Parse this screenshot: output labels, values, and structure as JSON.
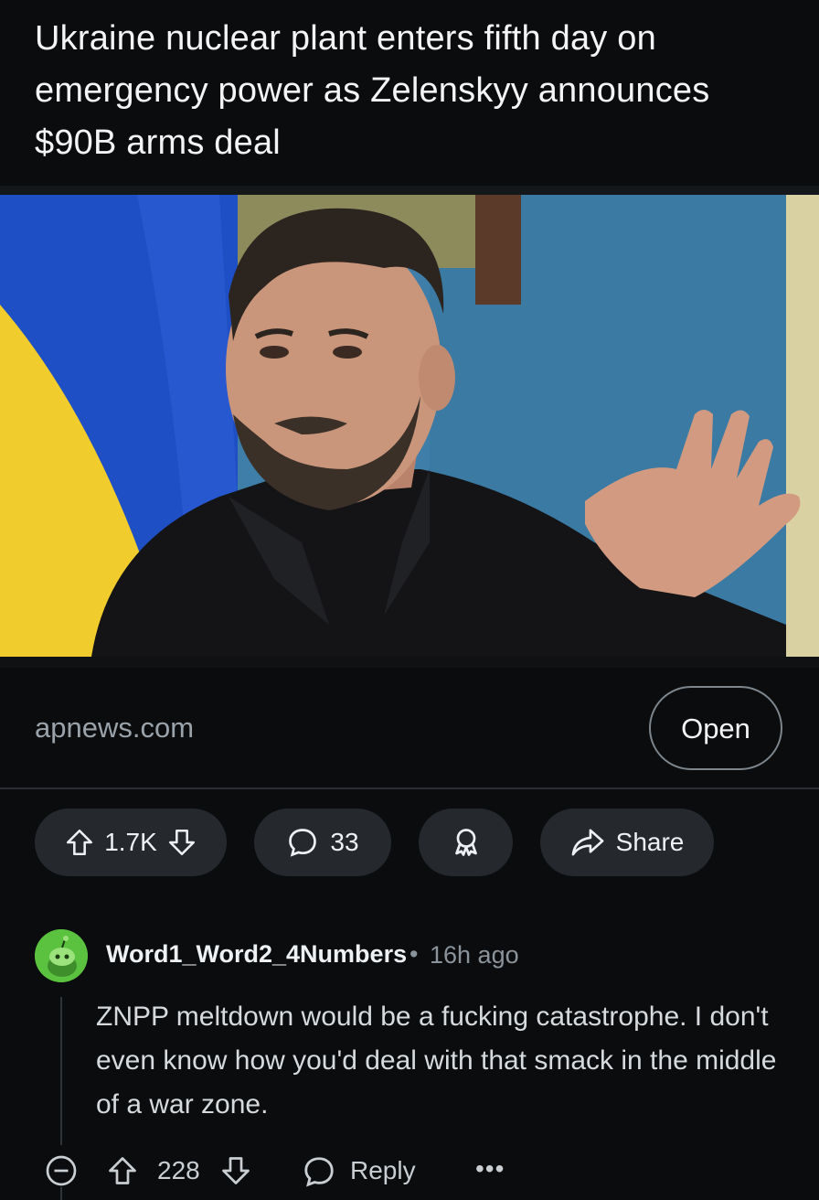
{
  "post": {
    "title": "Ukraine nuclear plant enters fifth day on emergency power as Zelenskyy announces $90B arms deal",
    "link_domain": "apnews.com",
    "open_label": "Open",
    "image_alt": "Zelenskyy speaking in front of a Ukrainian flag"
  },
  "actions": {
    "upvotes": "1.7K",
    "comments": "33",
    "share_label": "Share"
  },
  "comment": {
    "username": "Word1_Word2_4Numbers",
    "separator": "•",
    "age": "16h ago",
    "body": "ZNPP meltdown would be a fucking catastrophe. I don't even know how you'd deal with that smack in the middle of a war zone.",
    "score": "228",
    "reply_label": "Reply",
    "more_label": "•••"
  },
  "icons": [
    "upvote-icon",
    "downvote-icon",
    "comment-bubble-icon",
    "award-icon",
    "share-arrow-icon",
    "collapse-icon",
    "avatar-icon"
  ],
  "colors": {
    "background": "#0b0c0e",
    "pill": "#25292d",
    "avatar": "#5ac23f",
    "muted_text": "#8b949a"
  }
}
